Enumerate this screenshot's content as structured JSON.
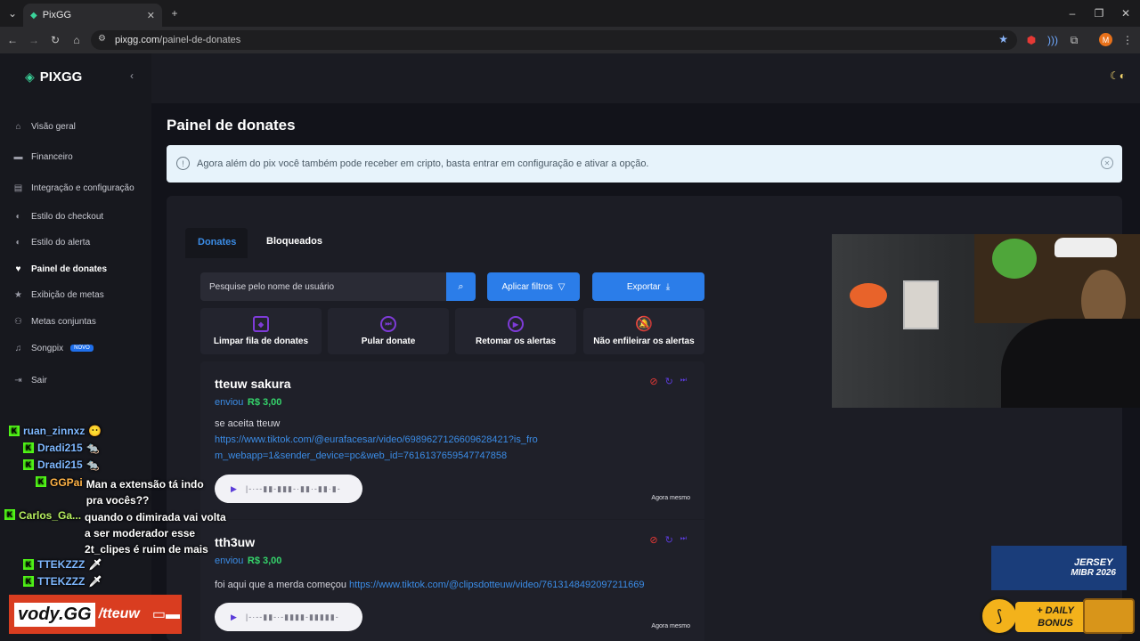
{
  "browser": {
    "tab_title": "PixGG",
    "url_host": "pixgg.com",
    "url_path": "/painel-de-donates",
    "profile_initial": "M"
  },
  "sidebar": {
    "logo": "PIXGG",
    "items": [
      {
        "label": "Visão geral",
        "icon": "home-icon"
      },
      {
        "label": "Financeiro",
        "icon": "wallet-icon"
      },
      {
        "label": "Integração e configuração",
        "icon": "settings-icon"
      },
      {
        "label": "Estilo do checkout",
        "icon": "palette-icon"
      },
      {
        "label": "Estilo do alerta",
        "icon": "palette-icon"
      },
      {
        "label": "Painel de donates",
        "icon": "gift-icon"
      },
      {
        "label": "Exibição de metas",
        "icon": "star-icon"
      },
      {
        "label": "Metas conjuntas",
        "icon": "users-icon"
      },
      {
        "label": "Songpix",
        "icon": "music-icon",
        "badge": "NOVO"
      },
      {
        "label": "Sair",
        "icon": "logout-icon"
      }
    ],
    "active_index": 5
  },
  "page": {
    "title": "Painel de donates",
    "alert_text": "Agora além do pix você também pode receber em cripto, basta entrar em configuração e ativar a opção."
  },
  "tabs": [
    "Donates",
    "Bloqueados"
  ],
  "toolbar": {
    "search_placeholder": "Pesquise pelo nome de usuário",
    "filter_label": "Aplicar filtros",
    "export_label": "Exportar"
  },
  "actions": [
    "Limpar fila de donates",
    "Pular donate",
    "Retomar os alertas",
    "Não enfileirar os alertas"
  ],
  "donates": [
    {
      "name": "tteuw sakura",
      "sent_label": "enviou",
      "amount": "R$ 3,00",
      "message": "se aceita tteuw",
      "link": "https://www.tiktok.com/@eurafacesar/video/6989627126609628421?is_from_webapp=1&sender_device=pc&web_id=7616137659547747858",
      "time": "Agora mesmo"
    },
    {
      "name": "tth3uw",
      "sent_label": "enviou",
      "amount": "R$ 3,00",
      "message": "foi aqui que a merda começou",
      "link": "https://www.tiktok.com/@clipsdotteuw/video/7613148492097211669",
      "time": "Agora mesmo"
    }
  ],
  "chat": [
    {
      "user": "ruan_zinnxz",
      "text": "",
      "emote": "😶"
    },
    {
      "user": "Dradi215",
      "text": "",
      "emote": "🐀"
    },
    {
      "user": "Dradi215",
      "text": "",
      "emote": "🐀"
    },
    {
      "user": "GGPai",
      "text": "Man a extensão tá indo pra vocês??"
    },
    {
      "user": "Carlos_Ga...",
      "text": "quando o dimirada vai volta a ser moderador esse 2t_clipes é ruim de mais"
    },
    {
      "user": "TTEKZZZ",
      "text": "",
      "emote": "🗡"
    },
    {
      "user": "TTEKZZZ",
      "text": "",
      "emote": "🗡"
    }
  ],
  "overlay": {
    "brand": "vody.GG",
    "brand_suffix": "/tteuw",
    "jersey_line1": "JERSEY",
    "jersey_line2": "MIBR 2026",
    "bonus_line1": "+ DAILY",
    "bonus_line2": "BONUS"
  }
}
